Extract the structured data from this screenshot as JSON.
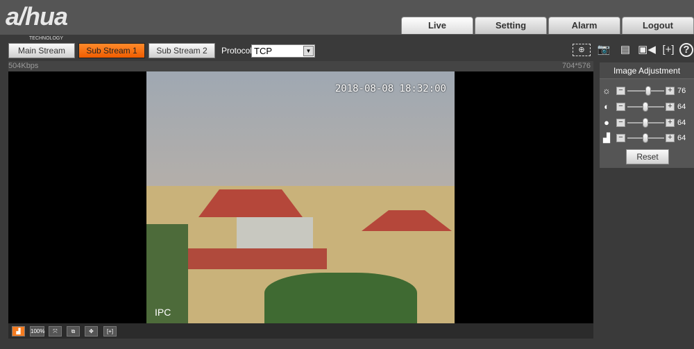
{
  "logo": {
    "brand": "alhua",
    "sub": "TECHNOLOGY"
  },
  "nav": {
    "tabs": [
      {
        "label": "Live"
      },
      {
        "label": "Setting"
      },
      {
        "label": "Alarm"
      },
      {
        "label": "Logout"
      }
    ],
    "active": "Live"
  },
  "streams": {
    "main": "Main Stream",
    "sub1": "Sub Stream 1",
    "sub2": "Sub Stream 2",
    "selected": "Sub Stream 1"
  },
  "protocol": {
    "label": "Protocol",
    "value": "TCP"
  },
  "video": {
    "bitrate": "504Kbps",
    "resolution": "704*576",
    "timestamp": "2018-08-08 18:32:00",
    "channel_name": "IPC"
  },
  "tools": [
    "regional-focus-icon",
    "snapshot-icon",
    "triple-snapshot-icon",
    "record-icon",
    "zoom-icon",
    "help-icon"
  ],
  "bottom_toolbar": {
    "zoom_label": "100%"
  },
  "image_adjustment": {
    "title": "Image Adjustment",
    "brightness": 76,
    "contrast": 64,
    "saturation": 64,
    "sharpness": 64,
    "reset_label": "Reset"
  },
  "colors": {
    "accent": "#f47b20"
  }
}
